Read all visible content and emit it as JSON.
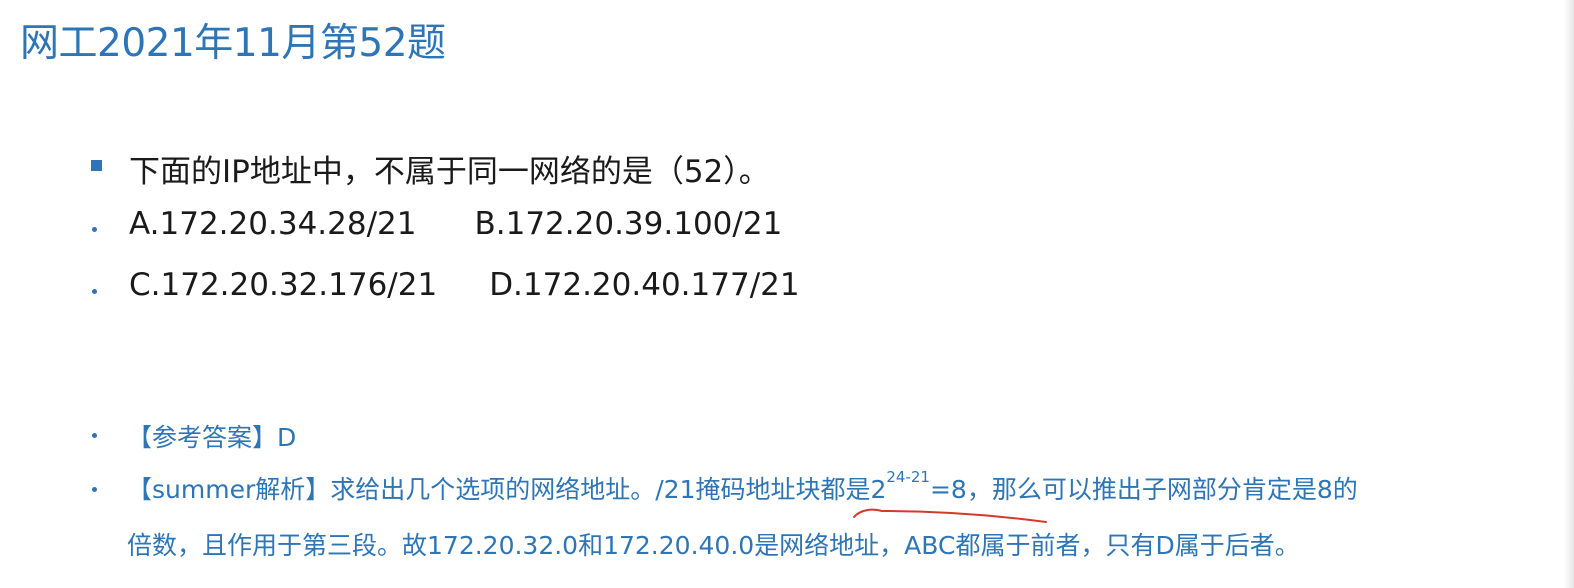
{
  "title": "网工2021年11月第52题",
  "question": {
    "stem": "下面的IP地址中，不属于同一网络的是（52）。",
    "options": {
      "a": "A.172.20.34.28/21",
      "b": "B.172.20.39.100/21",
      "c": "C.172.20.32.176/21",
      "d": "D.172.20.40.177/21"
    }
  },
  "answer": {
    "label": "【参考答案】D"
  },
  "analysis": {
    "line1_prefix": "【summer解析】求给出几个选项的网络地址。/21掩码地址块都是2",
    "line1_sup": "24-21",
    "line1_suffix": "=8，那么可以推出子网部分肯定是8的",
    "line2": "倍数，且作用于第三段。故172.20.32.0和172.20.40.0是网络地址，ABC都属于前者，只有D属于后者。"
  },
  "colors": {
    "accent": "#2e75b6",
    "text": "#1a1a1a",
    "annotation": "#d23a2e"
  }
}
